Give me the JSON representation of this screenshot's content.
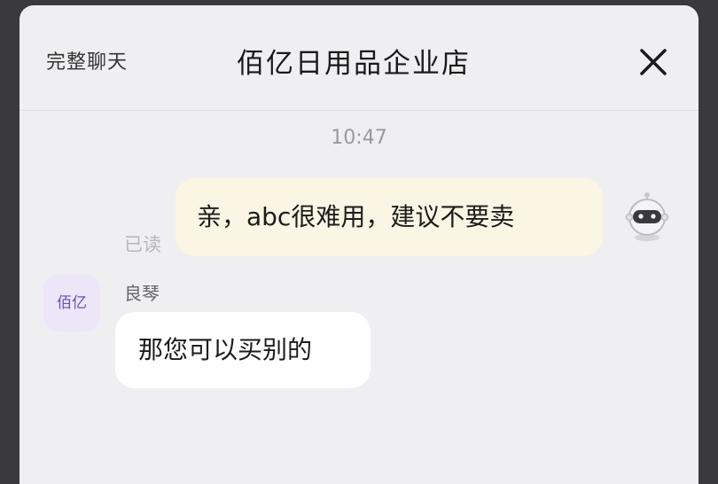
{
  "header": {
    "full_chat_label": "完整聊天",
    "shop_name": "佰亿日用品企业店",
    "close_icon": "close-icon"
  },
  "messages": {
    "timestamp": "10:47",
    "outgoing": {
      "text": "亲，abc很难用，建议不要卖",
      "read_status": "已读",
      "avatar_icon": "astronaut-avatar-icon"
    },
    "incoming": {
      "sender_name": "良琴",
      "avatar_label": "佰亿",
      "text": "那您可以买别的"
    }
  },
  "colors": {
    "outgoing_bubble": "#fbf5e3",
    "incoming_bubble": "#ffffff",
    "panel_background": "#efeff1",
    "shop_avatar_background": "#ece6f8"
  }
}
